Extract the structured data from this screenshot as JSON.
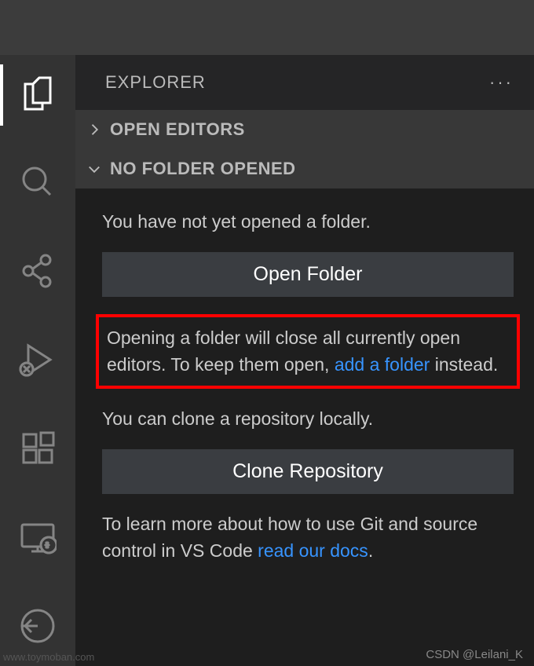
{
  "sidebar": {
    "title": "EXPLORER",
    "sections": {
      "open_editors": "OPEN EDITORS",
      "no_folder": "NO FOLDER OPENED"
    }
  },
  "content": {
    "no_folder_msg": "You have not yet opened a folder.",
    "open_folder_btn": "Open Folder",
    "tip_part1": "Opening a folder will close all currently open editors. To keep them open, ",
    "tip_link": "add a folder",
    "tip_part2": " instead.",
    "clone_msg": "You can clone a repository locally.",
    "clone_btn": "Clone Repository",
    "docs_part1": "To learn more about how to use Git and source control in VS Code ",
    "docs_link": "read our docs",
    "docs_part2": "."
  },
  "watermark": "CSDN @Leilani_K",
  "watermark_left": "www.toymoban.com"
}
